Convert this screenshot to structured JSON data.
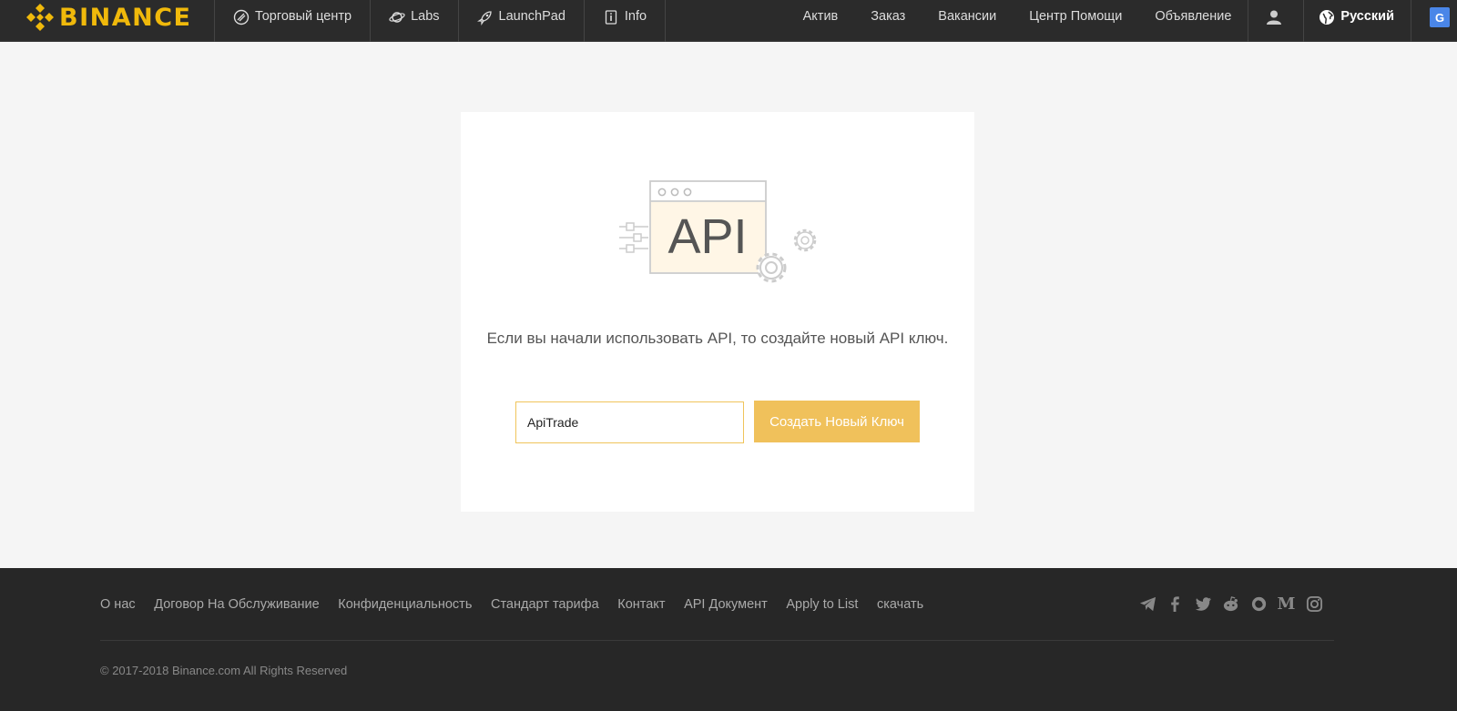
{
  "header": {
    "brand": "BINANCE",
    "nav_left": [
      {
        "label": "Торговый центр",
        "icon": "exchange-icon"
      },
      {
        "label": "Labs",
        "icon": "planet-icon"
      },
      {
        "label": "LaunchPad",
        "icon": "rocket-icon"
      },
      {
        "label": "Info",
        "icon": "info-icon"
      }
    ],
    "nav_right": [
      "Актив",
      "Заказ",
      "Вакансии",
      "Центр Помощи",
      "Объявление"
    ],
    "account_icon": "user-icon",
    "language": "Русский",
    "translate_icon": "google-translate-icon"
  },
  "api_card": {
    "illustration_text": "API",
    "message": "Если вы начали использовать API, то создайте новый API ключ.",
    "key_label_value": "ApiTrade",
    "create_button": "Создать Новый Ключ"
  },
  "footer": {
    "links": [
      "О нас",
      "Договор На Обслуживание",
      "Конфиденциальность",
      "Стандарт тарифа",
      "Контакт",
      "API Документ",
      "Apply to List",
      "скачать"
    ],
    "social_icons": [
      "telegram-icon",
      "facebook-icon",
      "twitter-icon",
      "reddit-icon",
      "wechat-icon",
      "medium-icon",
      "instagram-icon"
    ],
    "copyright": "© 2017-2018 Binance.com All Rights Reserved"
  },
  "colors": {
    "brand_yellow": "#f0b90b",
    "button_yellow": "#f0c15b",
    "header_bg": "#2b2b2b",
    "footer_bg": "#272727"
  }
}
